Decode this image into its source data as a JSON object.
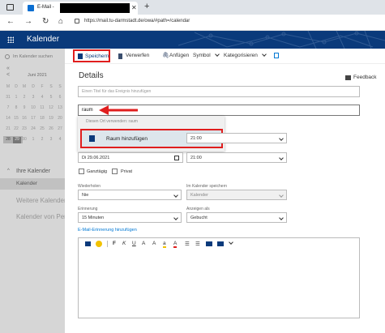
{
  "browser": {
    "tab_title": "E-Mail -",
    "url": "https://mail.tu-darmstadt.de/owa/#path=/calendar"
  },
  "app": {
    "title": "Kalender",
    "search_placeholder": "Im Kalender suchen"
  },
  "toolbar": {
    "save": "Speichern",
    "discard": "Verwerfen",
    "attach": "Anfügen",
    "symbol": "Symbol",
    "categorize": "Kategorisieren"
  },
  "sidebar": {
    "month": "Juni 2021",
    "weekdays": [
      "M",
      "D",
      "M",
      "D",
      "F",
      "S",
      "S"
    ],
    "weeks": [
      [
        "31",
        "1",
        "2",
        "3",
        "4",
        "5",
        "6"
      ],
      [
        "7",
        "8",
        "9",
        "10",
        "11",
        "12",
        "13"
      ],
      [
        "14",
        "15",
        "16",
        "17",
        "18",
        "19",
        "20"
      ],
      [
        "21",
        "22",
        "23",
        "24",
        "25",
        "26",
        "27"
      ],
      [
        "28",
        "29",
        "30",
        "1",
        "2",
        "3",
        "4"
      ]
    ],
    "section_title": "Ihre Kalender",
    "items": [
      "Kalender",
      "Weitere Kalender",
      "Kalender von Pers"
    ]
  },
  "form": {
    "heading": "Details",
    "feedback": "Feedback",
    "title_placeholder": "Einen Titel für das Ereignis hinzufügen",
    "location_value": "raum",
    "suggestion_header": "Diesen Ort verwenden: raum",
    "suggestion_add_room": "Raum hinzufügen",
    "start_time": "21:00",
    "end_date": "Di 29.06.2021",
    "end_time": "21:00",
    "allday": "Ganztägig",
    "private": "Privat",
    "repeat_label": "Wiederholen",
    "repeat_value": "Nie",
    "calendar_label": "Im Kalender speichern",
    "calendar_value": "Kalender",
    "reminder_label": "Erinnerung",
    "reminder_value": "15 Minuten",
    "show_as_label": "Anzeigen als",
    "show_as_value": "Gebucht",
    "email_reminder": "E-Mail-Erinnerung hinzufügen"
  },
  "colors": {
    "accent": "#0a3a7b",
    "highlight": "#e01e1e",
    "link": "#0078d4"
  }
}
